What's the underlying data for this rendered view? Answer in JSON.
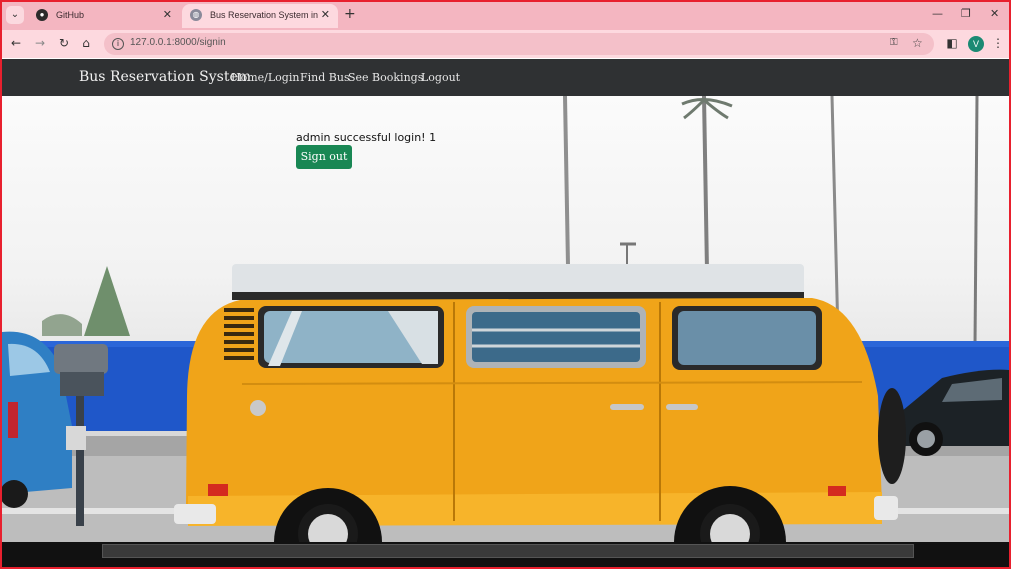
{
  "browser": {
    "tabs": [
      {
        "title": "GitHub",
        "close": "✕"
      },
      {
        "title": "Bus Reservation System in Djan",
        "close": "✕"
      }
    ],
    "menu_glyph": "⌄",
    "new_tab": "+",
    "window_controls": {
      "minimize": "—",
      "restore": "❐",
      "close": "✕"
    },
    "address": "127.0.0.1:8000/signin",
    "profile_initial": "V"
  },
  "navbar": {
    "brand": "Bus Reservation System",
    "links": [
      "Home/Login",
      "Find Bus",
      "See Bookings",
      "Logout"
    ]
  },
  "main": {
    "message": "admin successful login! 1",
    "signout_label": "Sign out"
  },
  "colors": {
    "browser_frame": "#f4b6c1",
    "navbar_bg": "#2f3133",
    "signout_bg": "#198754",
    "van_body": "#f0a419",
    "fence": "#1f57c9"
  }
}
